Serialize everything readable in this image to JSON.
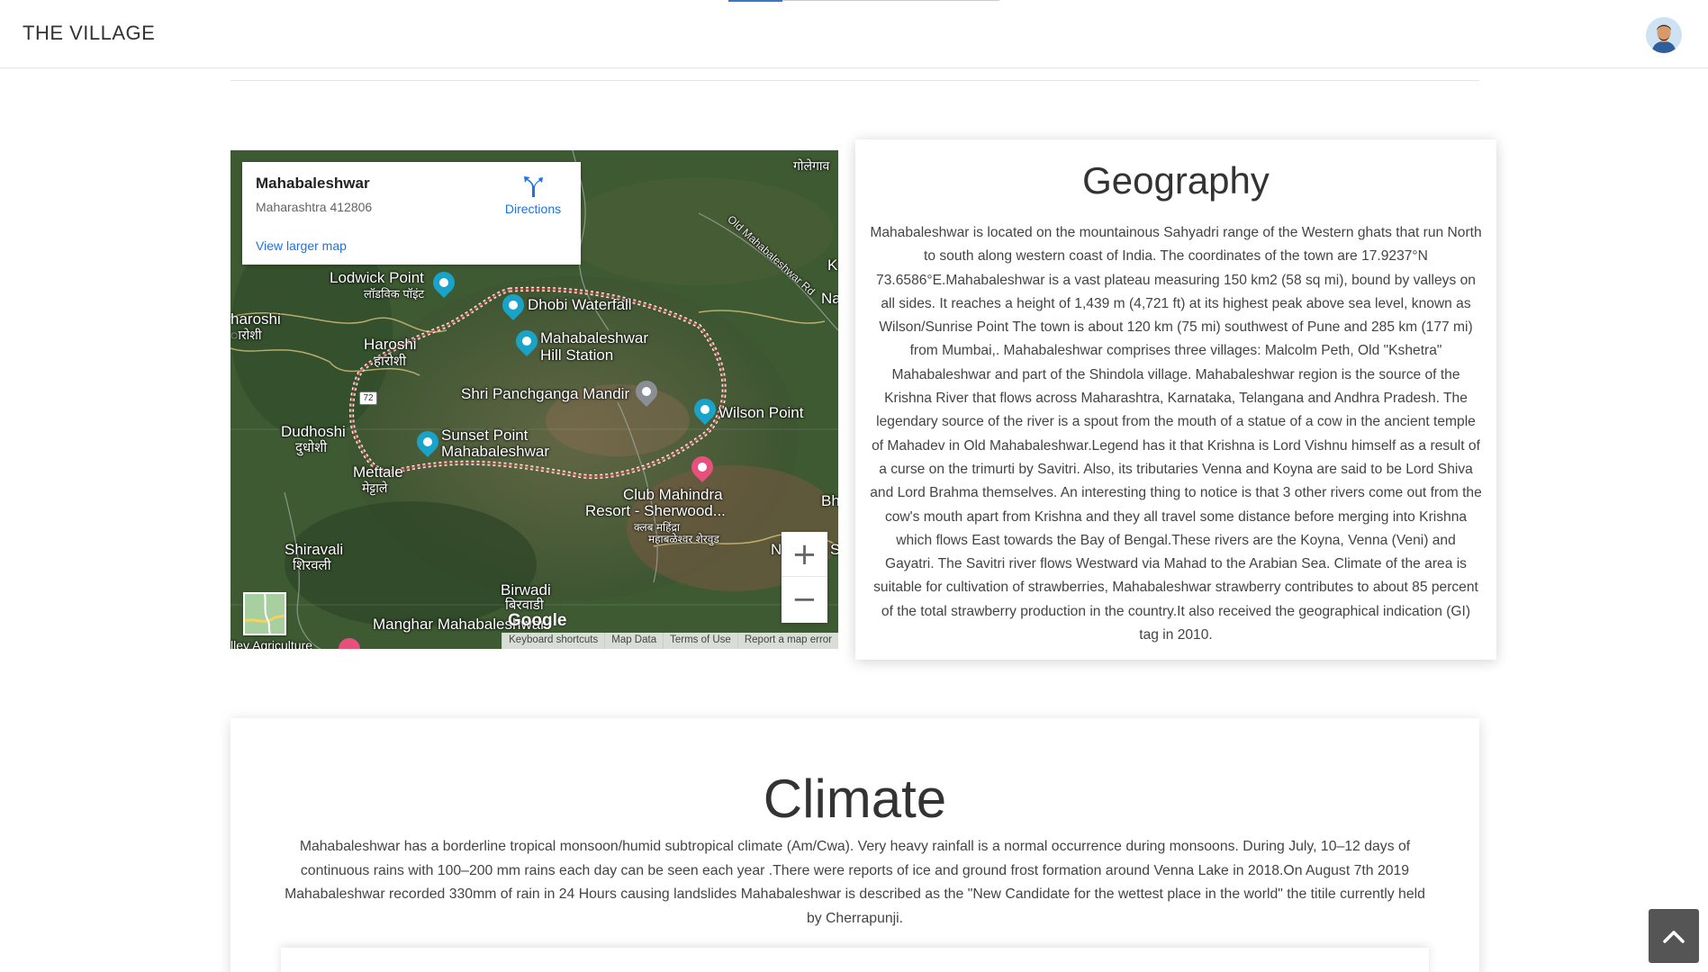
{
  "header": {
    "brand": "THE VILLAGE",
    "progress_fraction": 0.2,
    "avatar_icon": "user-avatar-icon"
  },
  "map": {
    "place_name": "Mahabaleshwar",
    "place_address": "Maharashtra 412806",
    "directions_label": "Directions",
    "view_larger_label": "View larger map",
    "zoom_in": "+",
    "zoom_out": "−",
    "google_logo": "Google",
    "attribution": [
      "Keyboard shortcuts",
      "Map Data",
      "Terms of Use",
      "Report a map error"
    ],
    "labels": {
      "lodwick": "Lodwick Point",
      "lodwick_local": "लॉडविक पॉइंट",
      "dhobi": "Dhobi Waterfall",
      "haroshi_edge": "haroshi",
      "haroshi_edge_local": "ारोशी",
      "haroshi": "Haroshi",
      "haroshi_local": "हारोशी",
      "mahabaleshwar_station_1": "Mahabaleshwar",
      "mahabaleshwar_station_2": "Hill Station",
      "panchganga": "Shri Panchganga Mandir",
      "wilson": "Wilson Point",
      "dudhoshi": "Dudhoshi",
      "dudhoshi_local": "दुधोशी",
      "sunset_1": "Sunset Point",
      "sunset_2": "Mahabaleshwar",
      "mettale": "Mettale",
      "mettale_local": "मेट्टाले",
      "club_1": "Club Mahindra",
      "club_2": "Resort - Sherwood...",
      "club_local_1": "क्लब महिंद्रा",
      "club_local_2": "महाबळेश्वर शेरवुड",
      "shiravali": "Shiravali",
      "shiravali_local": "शिरवली",
      "birwadi": "Birwadi",
      "birwadi_local": "बिरवाडी",
      "manghar": "Manghar Mahabaleshwar",
      "old_road": "Old Mahabaleshwar Rd",
      "golegaon": "गोलेगाव",
      "edge_k": "K",
      "edge_na": "Na",
      "edge_bh": "Bh",
      "edge_n": "N",
      "edge_s": "S",
      "alley": "lley Agriculture",
      "highway": "72"
    }
  },
  "geography": {
    "title": "Geography",
    "body": "Mahabaleshwar is located on the mountainous Sahyadri range of the Western ghats that run North to south along western coast of India. The coordinates of the town are 17.9237°N 73.6586°E.Mahabaleshwar is a vast plateau measuring 150 km2 (58 sq mi), bound by valleys on all sides. It reaches a height of 1,439 m (4,721 ft) at its highest peak above sea level, known as Wilson/Sunrise Point The town is about 120 km (75 mi) southwest of Pune and 285 km (177 mi) from Mumbai,. Mahabaleshwar comprises three villages: Malcolm Peth, Old \"Kshetra\" Mahabaleshwar and part of the Shindola village. Mahabaleshwar region is the source of the Krishna River that flows across Maharashtra, Karnataka, Telangana and Andhra Pradesh. The legendary source of the river is a spout from the mouth of a statue of a cow in the ancient temple of Mahadev in Old Mahabaleshwar.Legend has it that Krishna is Lord Vishnu himself as a result of a curse on the trimurti by Savitri. Also, its tributaries Venna and Koyna are said to be Lord Shiva and Lord Brahma themselves. An interesting thing to notice is that 3 other rivers come out from the cow's mouth apart from Krishna and they all travel some distance before merging into Krishna which flows East towards the Bay of Bengal.These rivers are the Koyna, Venna (Veni) and Gayatri. The Savitri river flows Westward via Mahad to the Arabian Sea. Climate of the area is suitable for cultivation of strawberries, Mahabaleshwar strawberry contributes to about 85 percent of the total strawberry production in the country.It also received the geographical indication (GI) tag in 2010."
  },
  "climate": {
    "title": "Climate",
    "body": "Mahabaleshwar has a borderline tropical monsoon/humid subtropical climate (Am/Cwa). Very heavy rainfall is a normal occurrence during monsoons. During July, 10–12 days of continuous rains with 100–200 mm rains each day can be seen each year .There were reports of ice and ground frost formation around Venna Lake in 2018.On August 7th 2019 Mahabaleshwar recorded 330mm of rain in 24 Hours causing landslides Mahabaleshwar is described as the \"New Candidate for the wettest place in the world\" the titile currently held by Cherrapunji."
  },
  "back_to_top_icon": "chevron-up-icon"
}
